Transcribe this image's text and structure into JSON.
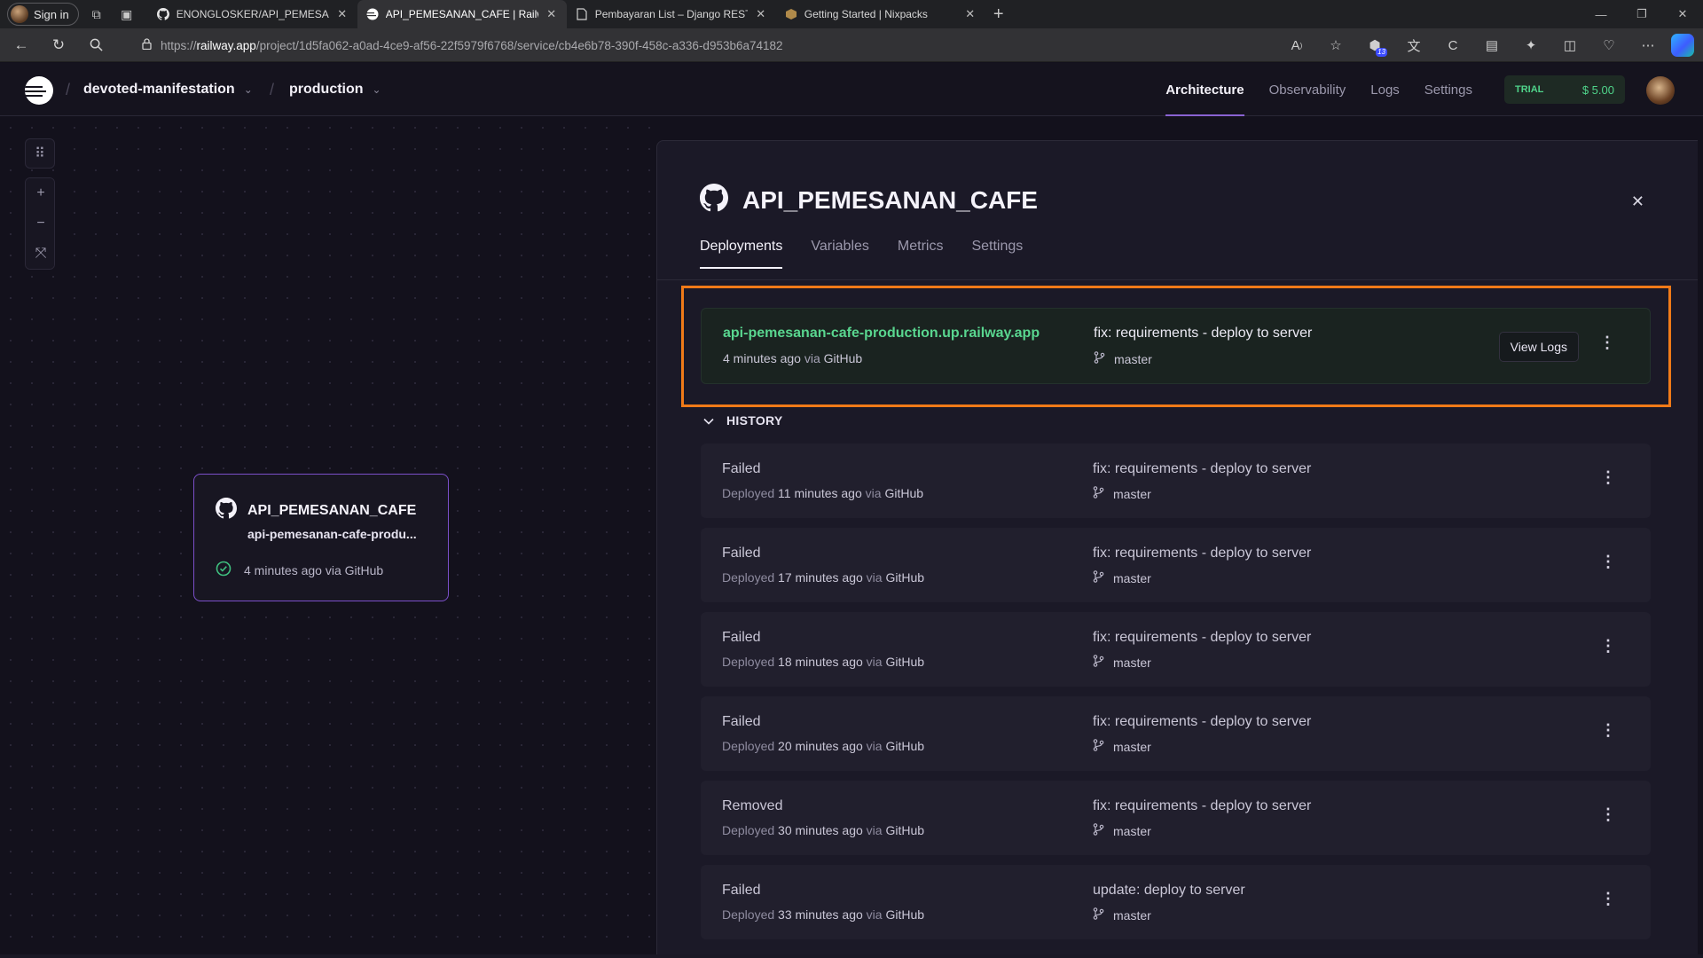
{
  "browser": {
    "profile_label": "Sign in",
    "tabs": [
      {
        "title": "ENONGLOSKER/API_PEMESANAN_CAFE"
      },
      {
        "title": "API_PEMESANAN_CAFE | Railway"
      },
      {
        "title": "Pembayaran List – Django REST framework"
      },
      {
        "title": "Getting Started | Nixpacks"
      }
    ],
    "url_prefix": "https://",
    "url_host": "railway.app",
    "url_path": "/project/1d5fa062-a0ad-4ce9-af56-22f5979f6768/service/cb4e6b78-390f-458c-a336-d953b6a74182",
    "extension_badge": "13"
  },
  "app": {
    "project": "devoted-manifestation",
    "environment": "production",
    "nav": [
      "Architecture",
      "Observability",
      "Logs",
      "Settings"
    ],
    "trial_badge": "TRIAL",
    "credit": "$ 5.00"
  },
  "service_card": {
    "name": "API_PEMESANAN_CAFE",
    "domain": "api-pemesanan-cafe-produ...",
    "status": "4 minutes ago via GitHub"
  },
  "panel": {
    "title": "API_PEMESANAN_CAFE",
    "tabs": [
      "Deployments",
      "Variables",
      "Metrics",
      "Settings"
    ],
    "active": {
      "url": "api-pemesanan-cafe-production.up.railway.app",
      "time": "4 minutes ago",
      "via": "via",
      "source": "GitHub",
      "message": "fix: requirements - deploy to server",
      "branch": "master",
      "view_logs": "View Logs"
    },
    "history_label": "HISTORY",
    "history": [
      {
        "status": "Failed",
        "deployed": "Deployed",
        "time": "11 minutes ago",
        "via": "via",
        "source": "GitHub",
        "message": "fix: requirements - deploy to server",
        "branch": "master"
      },
      {
        "status": "Failed",
        "deployed": "Deployed",
        "time": "17 minutes ago",
        "via": "via",
        "source": "GitHub",
        "message": "fix: requirements - deploy to server",
        "branch": "master"
      },
      {
        "status": "Failed",
        "deployed": "Deployed",
        "time": "18 minutes ago",
        "via": "via",
        "source": "GitHub",
        "message": "fix: requirements - deploy to server",
        "branch": "master"
      },
      {
        "status": "Failed",
        "deployed": "Deployed",
        "time": "20 minutes ago",
        "via": "via",
        "source": "GitHub",
        "message": "fix: requirements - deploy to server",
        "branch": "master"
      },
      {
        "status": "Removed",
        "deployed": "Deployed",
        "time": "30 minutes ago",
        "via": "via",
        "source": "GitHub",
        "message": "fix: requirements - deploy to server",
        "branch": "master"
      },
      {
        "status": "Failed",
        "deployed": "Deployed",
        "time": "33 minutes ago",
        "via": "via",
        "source": "GitHub",
        "message": "update: deploy to server",
        "branch": "master"
      }
    ]
  },
  "colors": {
    "accent": "#8a63d2",
    "success": "#59d68f",
    "highlight": "#f07a18"
  }
}
